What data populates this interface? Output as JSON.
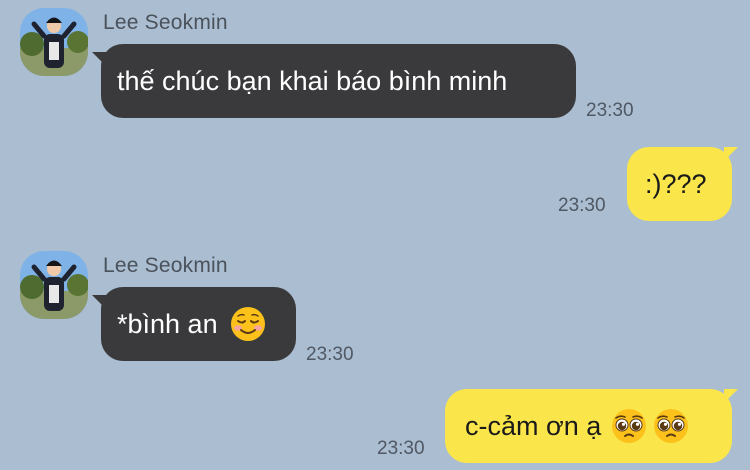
{
  "chat": {
    "messages": [
      {
        "direction": "incoming",
        "sender": "Lee Seokmin",
        "text": "thế chúc bạn khai báo bình minh",
        "time": "23:30"
      },
      {
        "direction": "outgoing",
        "text": ":)???",
        "time": "23:30"
      },
      {
        "direction": "incoming",
        "sender": "Lee Seokmin",
        "text": "*bình an",
        "emoji": [
          "smiling-face-emoji"
        ],
        "time": "23:30"
      },
      {
        "direction": "outgoing",
        "text": "c-cảm ơn ạ",
        "emoji": [
          "pleading-face-emoji",
          "pleading-face-emoji"
        ],
        "time": "23:30"
      }
    ]
  },
  "colors": {
    "background": "#abbdd0",
    "incoming_bubble": "#3a3a3c",
    "outgoing_bubble": "#fae64b"
  }
}
